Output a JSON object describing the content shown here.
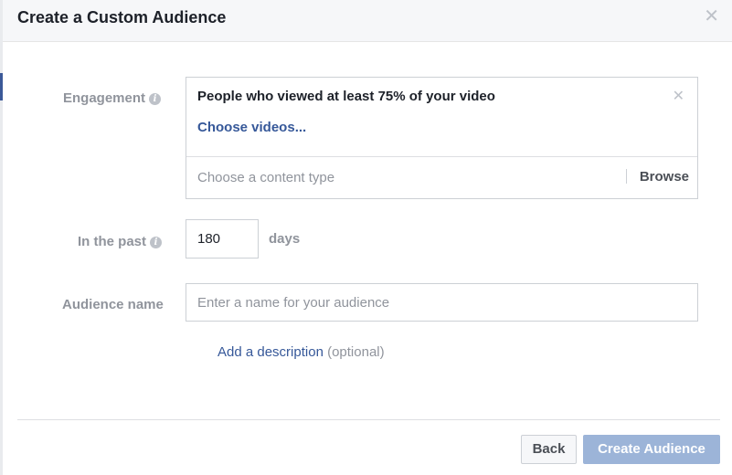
{
  "dialog": {
    "title": "Create a Custom Audience",
    "close_icon": "close-icon"
  },
  "engagement": {
    "label": "Engagement",
    "info_icon": "i",
    "selected_type": "People who viewed at least 75% of your video",
    "choose_videos_link": "Choose videos...",
    "content_type_placeholder": "Choose a content type",
    "browse_label": "Browse"
  },
  "retention": {
    "label": "In the past",
    "info_icon": "i",
    "value": "180",
    "unit": "days"
  },
  "audience_name": {
    "label": "Audience name",
    "placeholder": "Enter a name for your audience",
    "value": ""
  },
  "description": {
    "link_text": "Add a description",
    "optional_text": "(optional)"
  },
  "footer": {
    "back_label": "Back",
    "create_label": "Create Audience"
  },
  "colors": {
    "link": "#365899",
    "create_button_disabled": "#9cb4d8",
    "label_gray": "#90949c",
    "border": "#ccd0d5"
  }
}
